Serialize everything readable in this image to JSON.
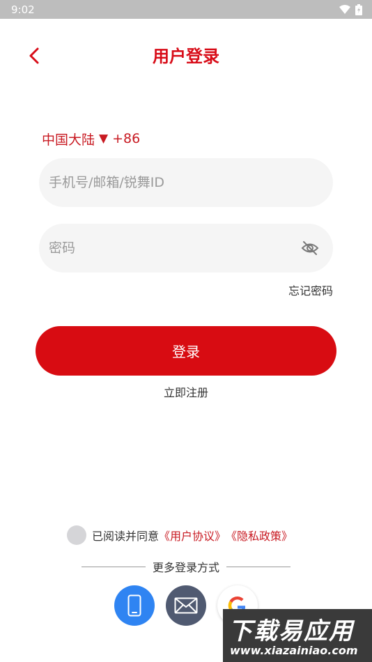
{
  "status_bar": {
    "time": "9:02"
  },
  "header": {
    "title": "用户登录"
  },
  "country": {
    "name": "中国大陆",
    "arrow": "▼",
    "code": "+86"
  },
  "account_field": {
    "placeholder": "手机号/邮箱/锐舞ID",
    "value": ""
  },
  "password_field": {
    "placeholder": "密码",
    "value": ""
  },
  "forgot_password": "忘记密码",
  "login_button": "登录",
  "register_link": "立即注册",
  "agreement": {
    "prefix": "已阅读并同意",
    "user_agreement": "《用户协议》",
    "privacy_policy": "《隐私政策》"
  },
  "more_login": "更多登录方式",
  "watermark": {
    "main": "下载易应用",
    "url": "www.xiazainiao.com"
  },
  "colors": {
    "accent": "#d80c12",
    "phone_btn": "#2f84f2",
    "mail_btn": "#505a71"
  }
}
